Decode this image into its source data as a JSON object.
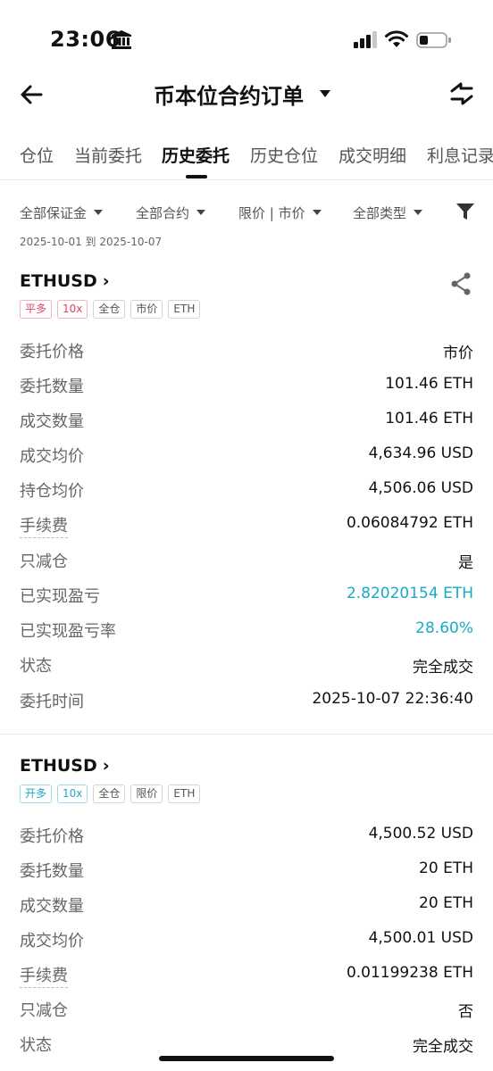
{
  "status_bar": {
    "time": "23:06"
  },
  "header": {
    "title": "币本位合约订单"
  },
  "tabs": [
    "仓位",
    "当前委托",
    "历史委托",
    "历史仓位",
    "成交明细",
    "利息记录"
  ],
  "active_tab": "历史委托",
  "filters": [
    "全部保证金",
    "全部合约",
    "限价 | 市价",
    "全部类型"
  ],
  "date_range": "2025-10-01 到 2025-10-07",
  "orders": [
    {
      "symbol": "ETHUSD",
      "tags": [
        "平多",
        "10x",
        "全仓",
        "市价",
        "ETH"
      ],
      "rows": [
        {
          "label": "委托价格",
          "value": "市价"
        },
        {
          "label": "委托数量",
          "value": "101.46 ETH"
        },
        {
          "label": "成交数量",
          "value": "101.46 ETH"
        },
        {
          "label": "成交均价",
          "value": "4,634.96 USD"
        },
        {
          "label": "持仓均价",
          "value": "4,506.06 USD"
        },
        {
          "label": "手续费",
          "value": "0.06084792 ETH"
        },
        {
          "label": "只减仓",
          "value": "是"
        },
        {
          "label": "已实现盈亏",
          "value": "2.82020154 ETH"
        },
        {
          "label": "已实现盈亏率",
          "value": "28.60%"
        },
        {
          "label": "状态",
          "value": "完全成交"
        },
        {
          "label": "委托时间",
          "value": "2025-10-07 22:36:40"
        }
      ]
    },
    {
      "symbol": "ETHUSD",
      "tags": [
        "开多",
        "10x",
        "全仓",
        "限价",
        "ETH"
      ],
      "rows": [
        {
          "label": "委托价格",
          "value": "4,500.52 USD"
        },
        {
          "label": "委托数量",
          "value": "20 ETH"
        },
        {
          "label": "成交数量",
          "value": "20 ETH"
        },
        {
          "label": "成交均价",
          "value": "4,500.01 USD"
        },
        {
          "label": "手续费",
          "value": "0.01199238 ETH"
        },
        {
          "label": "只减仓",
          "value": "否"
        },
        {
          "label": "状态",
          "value": "完全成交"
        }
      ]
    }
  ],
  "colors": {
    "profit": "#19aac6",
    "close_long": "#e0455f",
    "open_long": "#1ea8c4"
  },
  "icons": [
    "bank-icon",
    "signal-icon",
    "wifi-icon",
    "battery-icon",
    "back-arrow-icon",
    "caret-down-icon",
    "switch-icon",
    "filter-icon",
    "share-icon",
    "chevron-right-icon"
  ]
}
